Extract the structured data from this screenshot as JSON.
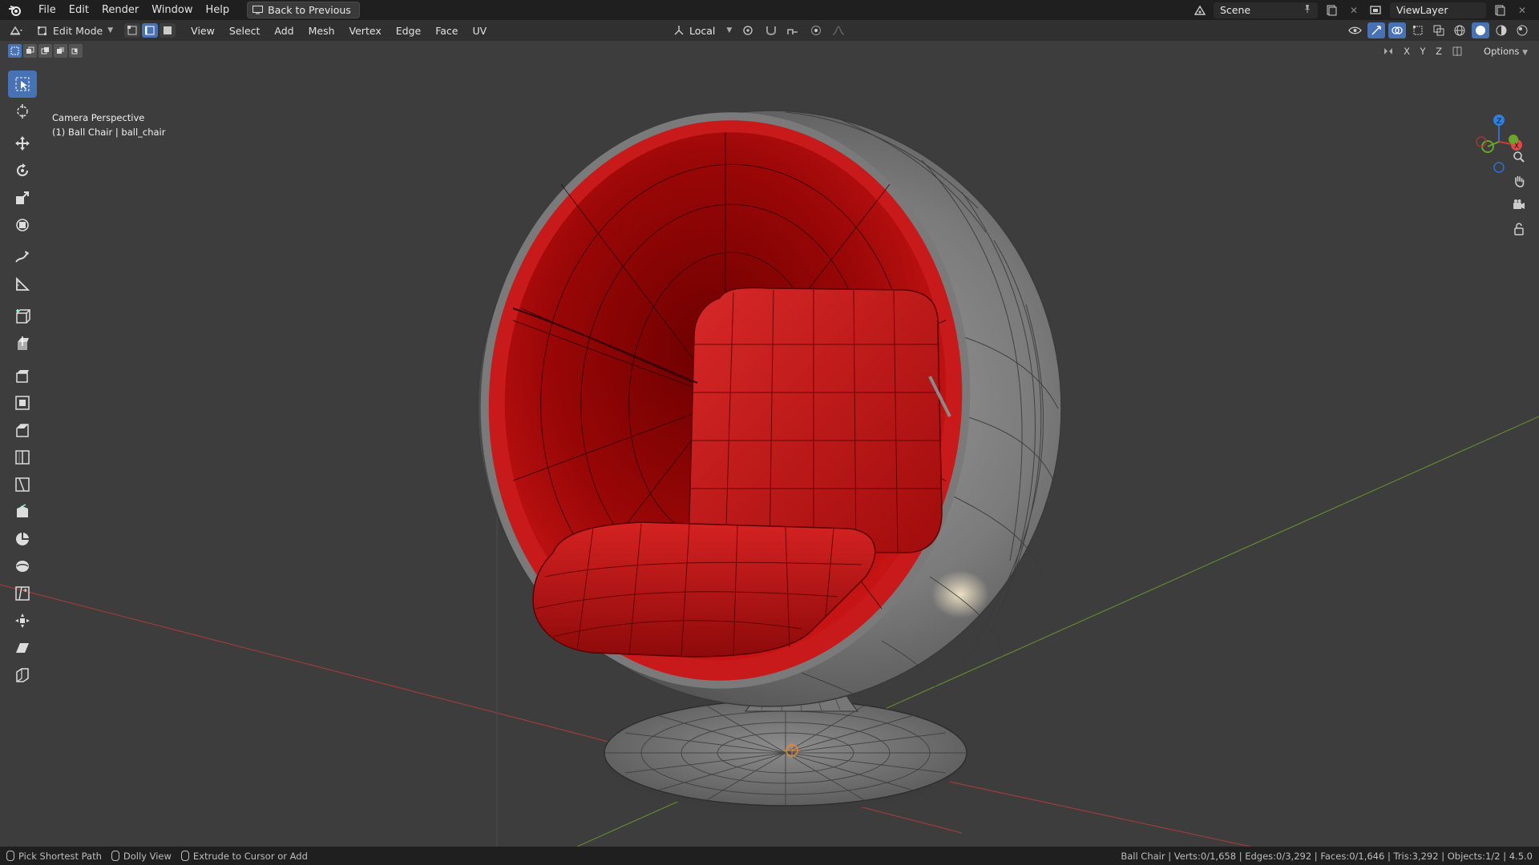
{
  "app": {
    "menus": [
      "File",
      "Edit",
      "Render",
      "Window",
      "Help"
    ],
    "back_button": "Back to Previous",
    "scene_label": "Scene",
    "view_layer_label": "ViewLayer"
  },
  "header": {
    "mode": "Edit Mode",
    "menus": [
      "View",
      "Select",
      "Add",
      "Mesh",
      "Vertex",
      "Edge",
      "Face",
      "UV"
    ],
    "transform_orientation": "Local"
  },
  "subheader": {
    "axes": [
      "X",
      "Y",
      "Z"
    ],
    "options_label": "Options"
  },
  "viewport": {
    "view_name": "Camera Perspective",
    "object_info": "(1) Ball Chair | ball_chair",
    "gizmo": {
      "x": "X",
      "y": "Y",
      "z": "Z"
    }
  },
  "toolbar": {
    "tools": [
      "select-box-icon",
      "cursor-icon",
      "move-icon",
      "rotate-icon",
      "scale-icon",
      "transform-icon",
      "annotate-icon",
      "measure-icon",
      "add-cube-icon",
      "extrude-region-icon",
      "extrude-icon",
      "inset-faces-icon",
      "bevel-icon",
      "loop-cut-icon",
      "knife-icon",
      "poly-build-icon",
      "spin-icon",
      "smooth-icon",
      "edge-slide-icon",
      "shrink-fatten-icon",
      "shear-icon",
      "rip-region-icon"
    ]
  },
  "statusbar": {
    "hints": [
      "Pick Shortest Path",
      "Dolly View",
      "Extrude to Cursor or Add"
    ],
    "stats": "Ball Chair | Verts:0/1,658 | Edges:0/3,292 | Faces:0/1,646 | Tris:3,292 | Objects:1/2 | 4.5.0"
  },
  "colors": {
    "accent": "#4772b3",
    "chair_red": "#c81a1a",
    "shell_grey": "#8a8a8a",
    "axis_x": "#b43c3c",
    "axis_y": "#6b9a2e"
  }
}
